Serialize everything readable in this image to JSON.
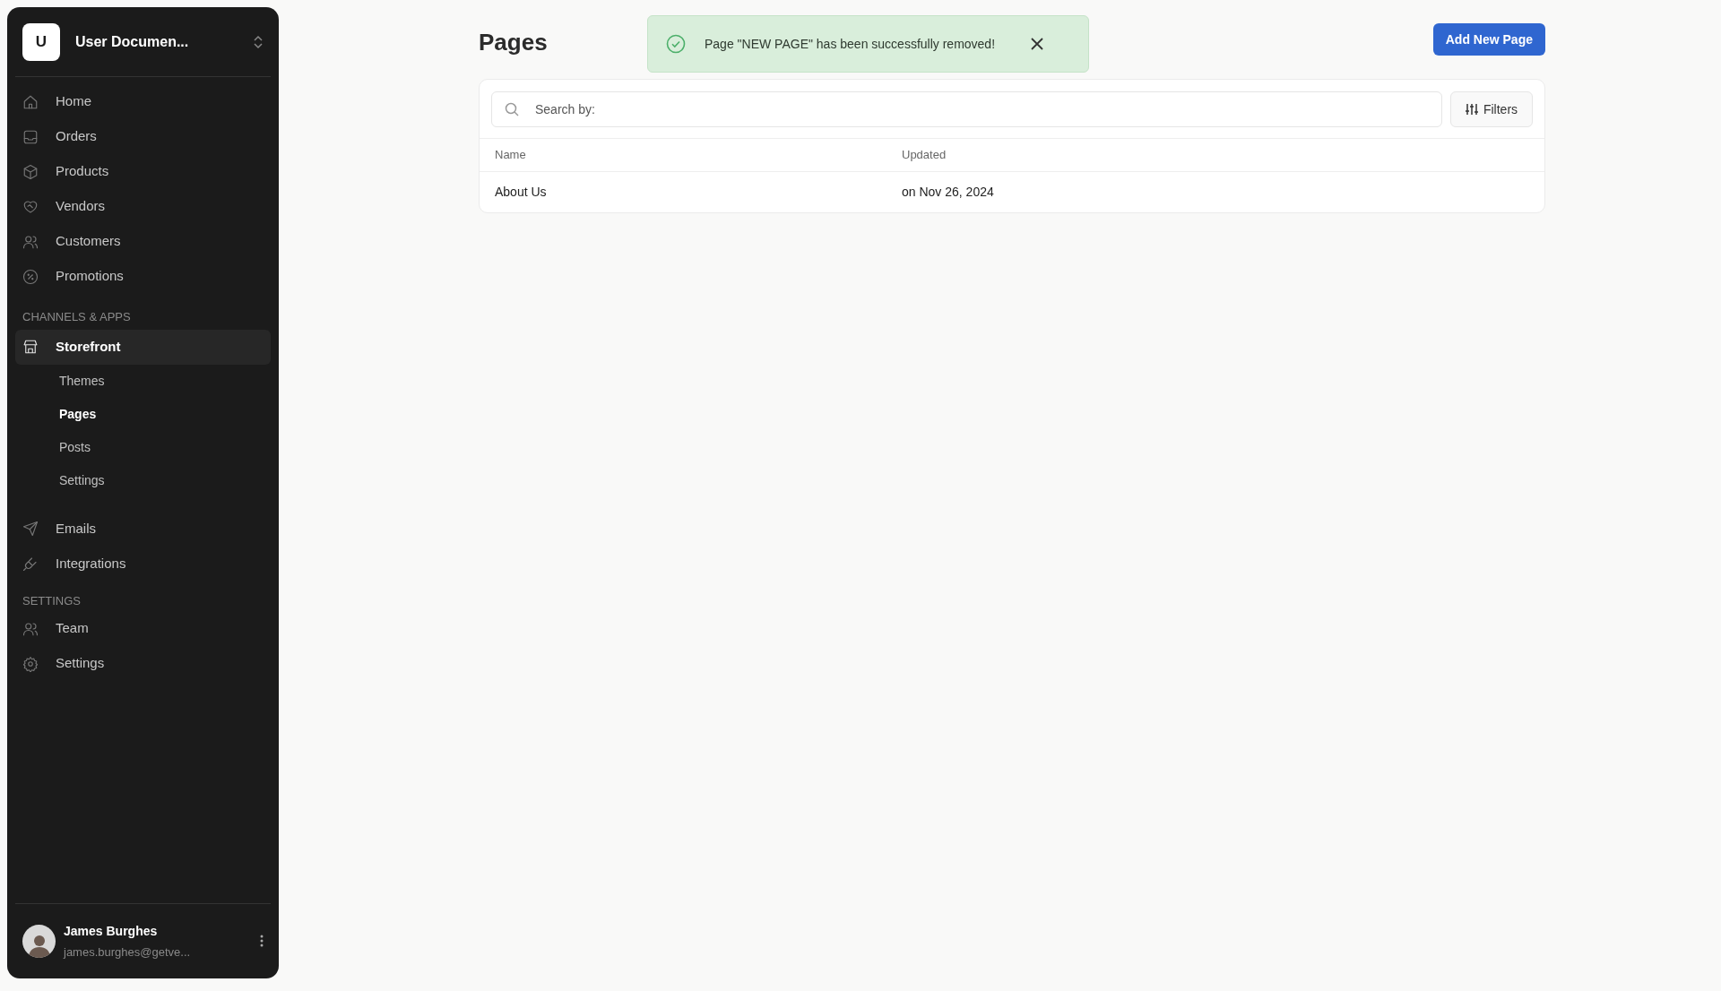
{
  "workspace": {
    "initial": "U",
    "name": "User Documen..."
  },
  "nav": [
    {
      "label": "Home",
      "selected": false
    },
    {
      "label": "Orders",
      "selected": false
    },
    {
      "label": "Products",
      "selected": false
    },
    {
      "label": "Vendors",
      "selected": false
    },
    {
      "label": "Customers",
      "selected": false
    },
    {
      "label": "Promotions",
      "selected": false
    }
  ],
  "channels": {
    "heading": "CHANNELS & APPS",
    "items": [
      {
        "label": "Storefront",
        "selected": true,
        "children": [
          {
            "label": "Themes",
            "selected": false
          },
          {
            "label": "Pages",
            "selected": true
          },
          {
            "label": "Posts",
            "selected": false
          },
          {
            "label": "Settings",
            "selected": false
          }
        ]
      },
      {
        "label": "Emails",
        "selected": false
      },
      {
        "label": "Integrations",
        "selected": false
      }
    ]
  },
  "settings": {
    "heading": "SETTINGS",
    "items": [
      {
        "label": "Team",
        "selected": false
      },
      {
        "label": "Settings",
        "selected": false
      }
    ]
  },
  "user": {
    "name": "James Burghes",
    "email": "james.burghes@getve..."
  },
  "page": {
    "title": "Pages",
    "add_button": "Add New Page"
  },
  "toast": {
    "message": "Page \"NEW PAGE\" has been successfully removed!"
  },
  "search": {
    "placeholder": "Search by:"
  },
  "filters_button": "Filters",
  "table": {
    "columns": [
      "Name",
      "Updated"
    ],
    "rows": [
      [
        "About Us",
        "on Nov 26, 2024"
      ]
    ]
  }
}
